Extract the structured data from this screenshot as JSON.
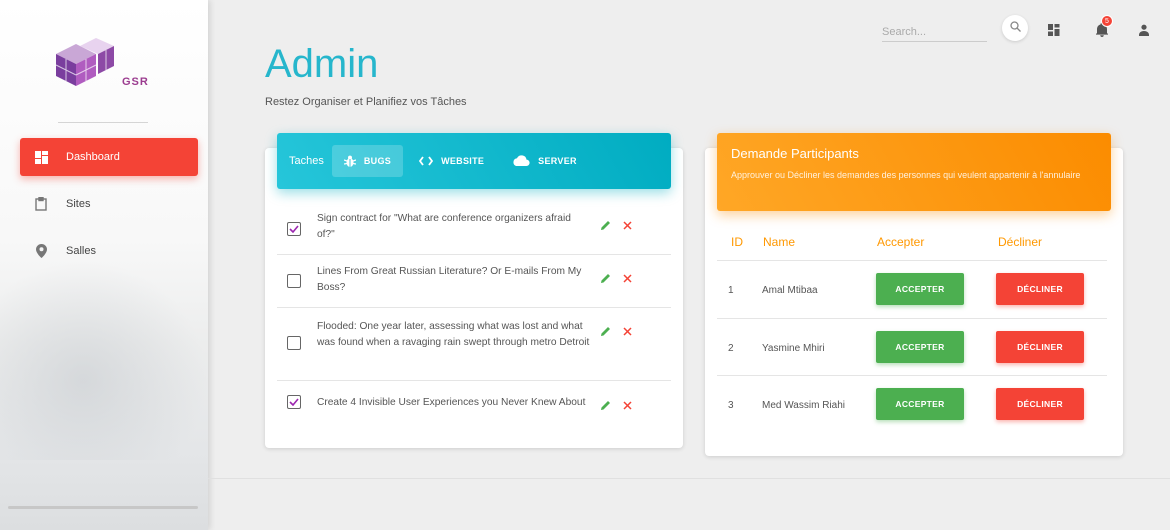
{
  "brand": {
    "logo_text": "GSR"
  },
  "sidebar": {
    "items": [
      {
        "label": "Dashboard",
        "icon": "dashboard-icon",
        "active": true
      },
      {
        "label": "Sites",
        "icon": "clipboard-icon",
        "active": false
      },
      {
        "label": "Salles",
        "icon": "location-pin-icon",
        "active": false
      }
    ]
  },
  "header": {
    "title": "Admin",
    "subtitle": "Restez Organiser et Planifiez vos Tâches",
    "search_placeholder": "Search...",
    "notification_count": "5"
  },
  "tasks_card": {
    "label": "Taches",
    "tabs": [
      {
        "label": "BUGS",
        "icon": "bug-icon"
      },
      {
        "label": "WEBSITE",
        "icon": "code-icon"
      },
      {
        "label": "SERVER",
        "icon": "cloud-icon"
      }
    ],
    "tasks": [
      {
        "text": "Sign contract for \"What are conference organizers afraid of?\"",
        "checked": true
      },
      {
        "text": "Lines From Great Russian Literature? Or E-mails From My Boss?",
        "checked": false
      },
      {
        "text": "Flooded: One year later, assessing what was lost and what was found when a ravaging rain swept through metro Detroit",
        "checked": false
      },
      {
        "text": "Create 4 Invisible User Experiences you Never Knew About",
        "checked": true
      }
    ]
  },
  "requests_card": {
    "title": "Demande Participants",
    "description": "Approuver ou Décliner les demandes des personnes qui veulent appartenir à l'annulaire",
    "columns": [
      "ID",
      "Name",
      "Accepter",
      "Décliner"
    ],
    "rows": [
      {
        "id": "1",
        "name": "Amal Mtibaa",
        "accept": "ACCEPTER",
        "decline": "DÉCLINER"
      },
      {
        "id": "2",
        "name": "Yasmine Mhiri",
        "accept": "ACCEPTER",
        "decline": "DÉCLINER"
      },
      {
        "id": "3",
        "name": "Med Wassim Riahi",
        "accept": "ACCEPTER",
        "decline": "DÉCLINER"
      }
    ]
  },
  "colors": {
    "primary": "#26b6cc",
    "danger": "#f44336",
    "success": "#4caf50",
    "warning": "#fb8c00"
  }
}
